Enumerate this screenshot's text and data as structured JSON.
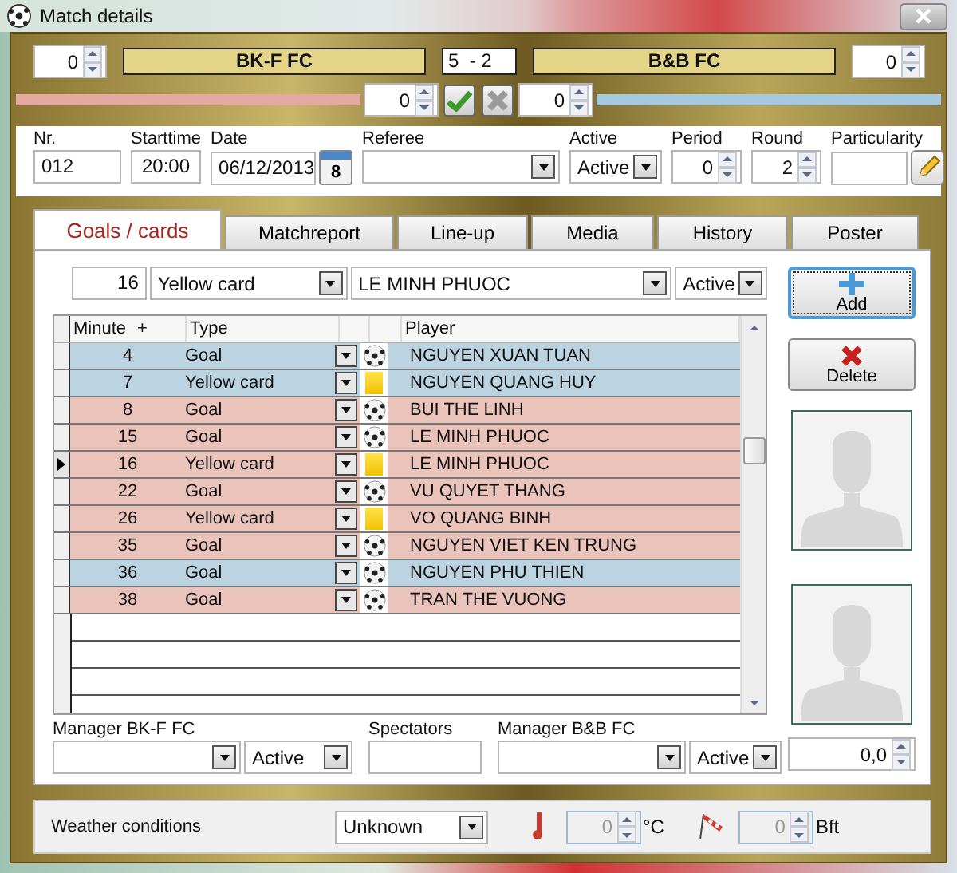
{
  "window": {
    "title": "Match details"
  },
  "score": {
    "home_team": "BK-F FC",
    "away_team": "B&B FC",
    "result": "5  - 2",
    "home_outer": "0",
    "away_outer": "0",
    "home_inner": "0",
    "away_inner": "0"
  },
  "info": {
    "nr_label": "Nr.",
    "nr": "012",
    "starttime_label": "Starttime",
    "starttime": "20:00",
    "date_label": "Date",
    "date": "06/12/2013",
    "calendar_day": "8",
    "referee_label": "Referee",
    "active_label": "Active",
    "active": "Active",
    "period_label": "Period",
    "period": "0",
    "round_label": "Round",
    "round": "2",
    "particularity_label": "Particularity"
  },
  "tabs": [
    {
      "label": "Goals / cards",
      "selected": true
    },
    {
      "label": "Matchreport",
      "selected": false
    },
    {
      "label": "Line-up",
      "selected": false
    },
    {
      "label": "Media",
      "selected": false
    },
    {
      "label": "History",
      "selected": false
    },
    {
      "label": "Poster",
      "selected": false
    }
  ],
  "entry": {
    "minute": "16",
    "type": "Yellow card",
    "player": "LE MINH PHUOC",
    "status": "Active"
  },
  "buttons": {
    "add": "Add",
    "delete": "Delete"
  },
  "grid": {
    "columns": [
      "Minute",
      "+",
      "Type",
      "Player"
    ],
    "rows": [
      {
        "minute": "4",
        "type": "Goal",
        "kind": "goal",
        "player": "NGUYEN XUAN TUAN",
        "color": "#bcd3e2",
        "selected": false
      },
      {
        "minute": "7",
        "type": "Yellow card",
        "kind": "yellow_card",
        "player": "NGUYEN QUANG HUY",
        "color": "#bcd3e2",
        "selected": false
      },
      {
        "minute": "8",
        "type": "Goal",
        "kind": "goal",
        "player": "BUI THE LINH",
        "color": "#eac3bb",
        "selected": false
      },
      {
        "minute": "15",
        "type": "Goal",
        "kind": "goal",
        "player": "LE MINH PHUOC",
        "color": "#eac3bb",
        "selected": false
      },
      {
        "minute": "16",
        "type": "Yellow card",
        "kind": "yellow_card",
        "player": "LE MINH PHUOC",
        "color": "#eac3bb",
        "selected": true
      },
      {
        "minute": "22",
        "type": "Goal",
        "kind": "goal",
        "player": "VU QUYET THANG",
        "color": "#eac3bb",
        "selected": false
      },
      {
        "minute": "26",
        "type": "Yellow card",
        "kind": "yellow_card",
        "player": "VO QUANG BINH",
        "color": "#eac3bb",
        "selected": false
      },
      {
        "minute": "35",
        "type": "Goal",
        "kind": "goal",
        "player": "NGUYEN VIET KEN TRUNG",
        "color": "#eac3bb",
        "selected": false
      },
      {
        "minute": "36",
        "type": "Goal",
        "kind": "goal",
        "player": "NGUYEN PHU THIEN",
        "color": "#bcd3e2",
        "selected": false
      },
      {
        "minute": "38",
        "type": "Goal",
        "kind": "goal",
        "player": "TRAN THE VUONG",
        "color": "#eac3bb",
        "selected": false
      }
    ]
  },
  "bottom": {
    "manager_home_label": "Manager BK-F FC",
    "manager_home_status": "Active",
    "spectators_label": "Spectators",
    "manager_away_label": "Manager B&B FC",
    "manager_away_status": "Active",
    "rating": "0,0"
  },
  "weather": {
    "label": "Weather conditions",
    "condition": "Unknown",
    "temperature": "0",
    "temperature_unit": "°C",
    "wind": "0",
    "wind_unit": "Bft"
  }
}
